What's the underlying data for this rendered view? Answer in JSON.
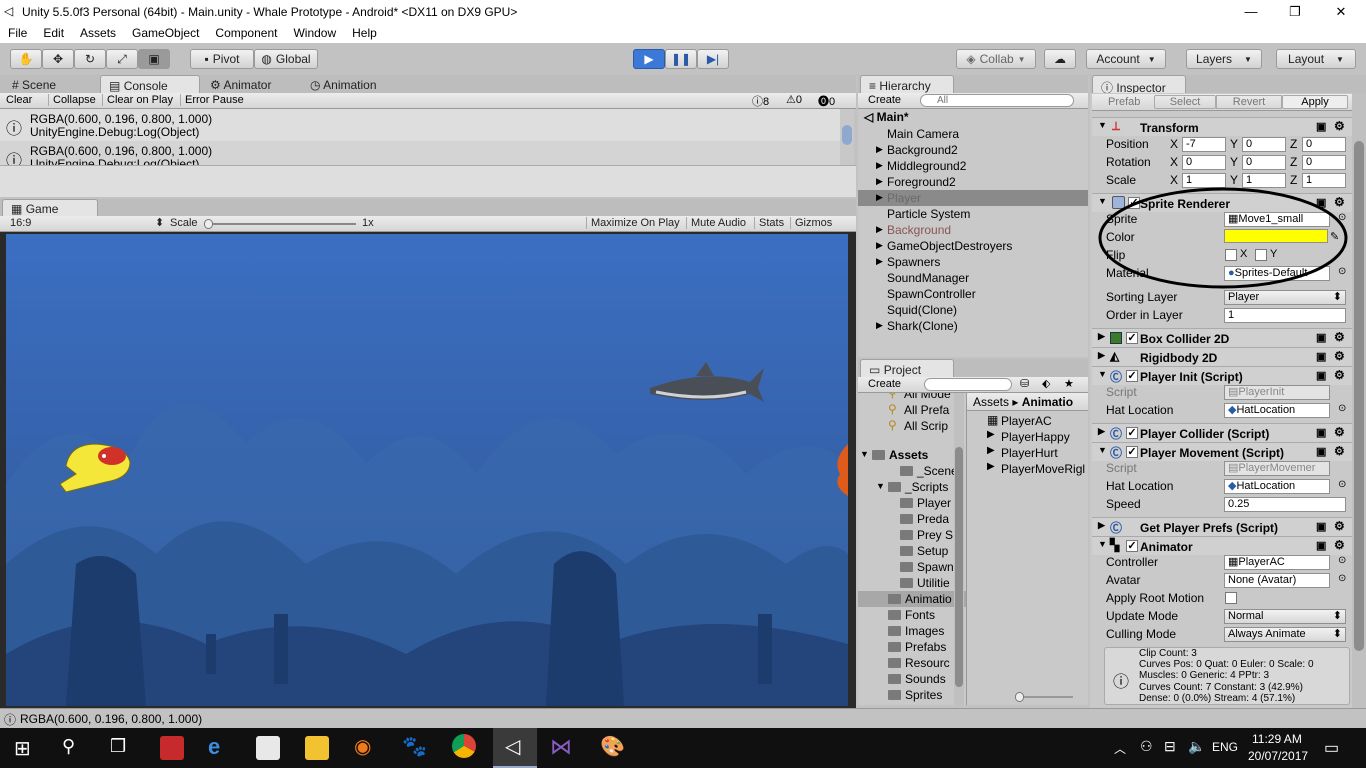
{
  "window": {
    "title": "Unity 5.5.0f3 Personal (64bit) - Main.unity - Whale Prototype - Android* <DX11 on DX9 GPU>",
    "minimize": "—",
    "maximize": "❐",
    "close": "✕"
  },
  "menu": [
    "File",
    "Edit",
    "Assets",
    "GameObject",
    "Component",
    "Window",
    "Help"
  ],
  "toolbar": {
    "pivot": "Pivot",
    "global": "Global",
    "collab": "Collab",
    "account": "Account",
    "layers": "Layers",
    "layout": "Layout"
  },
  "tabs_left": {
    "scene": "Scene",
    "console": "Console",
    "animator": "Animator",
    "animation": "Animation"
  },
  "console": {
    "clear": "Clear",
    "collapse": "Collapse",
    "clear_on_play": "Clear on Play",
    "error_pause": "Error Pause",
    "count_info": "8",
    "count_warn": "0",
    "count_err": "0",
    "entries": [
      {
        "line1": "RGBA(0.600, 0.196, 0.800, 1.000)",
        "line2": "UnityEngine.Debug:Log(Object)"
      },
      {
        "line1": "RGBA(0.600, 0.196, 0.800, 1.000)",
        "line2": "UnityEngine.Debug:Log(Object)"
      }
    ]
  },
  "game": {
    "tab": "Game",
    "aspect": "16:9",
    "scale_label": "Scale",
    "scale_value": "1x",
    "maximize": "Maximize On Play",
    "mute": "Mute Audio",
    "stats": "Stats",
    "gizmos": "Gizmos"
  },
  "hierarchy": {
    "tab": "Hierarchy",
    "create": "Create",
    "search_placeholder": "All",
    "scene": "Main*",
    "items": [
      {
        "label": "Main Camera",
        "arrow": false,
        "dim": false,
        "sel": false
      },
      {
        "label": "Background2",
        "arrow": true,
        "dim": false,
        "sel": false
      },
      {
        "label": "Middleground2",
        "arrow": true,
        "dim": false,
        "sel": false
      },
      {
        "label": "Foreground2",
        "arrow": true,
        "dim": false,
        "sel": false
      },
      {
        "label": "Player",
        "arrow": true,
        "dim": true,
        "sel": true
      },
      {
        "label": "Particle System",
        "arrow": false,
        "dim": false,
        "sel": false
      },
      {
        "label": "Background",
        "arrow": true,
        "dim": true,
        "sel": false
      },
      {
        "label": "GameObjectDestroyers",
        "arrow": true,
        "dim": false,
        "sel": false
      },
      {
        "label": "Spawners",
        "arrow": true,
        "dim": false,
        "sel": false
      },
      {
        "label": "SoundManager",
        "arrow": false,
        "dim": false,
        "sel": false
      },
      {
        "label": "SpawnController",
        "arrow": false,
        "dim": false,
        "sel": false
      },
      {
        "label": "Squid(Clone)",
        "arrow": false,
        "dim": false,
        "sel": false
      },
      {
        "label": "Shark(Clone)",
        "arrow": true,
        "dim": false,
        "sel": false
      }
    ]
  },
  "project": {
    "tab": "Project",
    "create": "Create",
    "favorites": [
      "All Mode",
      "All Prefa",
      "All Scrip"
    ],
    "tree": [
      {
        "label": "Assets",
        "bold": true,
        "depth": 0
      },
      {
        "label": "_Scenes",
        "bold": false,
        "depth": 2
      },
      {
        "label": "_Scripts",
        "bold": false,
        "depth": 1
      },
      {
        "label": "Player",
        "bold": false,
        "depth": 2
      },
      {
        "label": "Preda",
        "bold": false,
        "depth": 2
      },
      {
        "label": "Prey S",
        "bold": false,
        "depth": 2
      },
      {
        "label": "Setup",
        "bold": false,
        "depth": 2
      },
      {
        "label": "Spawn",
        "bold": false,
        "depth": 2
      },
      {
        "label": "Utilitie",
        "bold": false,
        "depth": 2
      },
      {
        "label": "Animatio",
        "bold": false,
        "depth": 1
      },
      {
        "label": "Fonts",
        "bold": false,
        "depth": 1
      },
      {
        "label": "Images",
        "bold": false,
        "depth": 1
      },
      {
        "label": "Prefabs",
        "bold": false,
        "depth": 1
      },
      {
        "label": "Resourc",
        "bold": false,
        "depth": 1
      },
      {
        "label": "Sounds",
        "bold": false,
        "depth": 1
      },
      {
        "label": "Sprites",
        "bold": false,
        "depth": 1
      }
    ],
    "breadcrumb_root": "Assets",
    "breadcrumb_current": "Animatio",
    "files": [
      "PlayerAC",
      "PlayerHappy",
      "PlayerHurt",
      "PlayerMoveRigl"
    ]
  },
  "inspector": {
    "tab": "Inspector",
    "prefab": "Prefab",
    "select": "Select",
    "revert": "Revert",
    "apply": "Apply",
    "transform": {
      "title": "Transform",
      "position_label": "Position",
      "rotation_label": "Rotation",
      "scale_label": "Scale",
      "pos": [
        "-7",
        "0",
        "0"
      ],
      "rot": [
        "0",
        "0",
        "0"
      ],
      "scl": [
        "1",
        "1",
        "1"
      ],
      "x": "X",
      "y": "Y",
      "z": "Z"
    },
    "sprite_renderer": {
      "title": "Sprite Renderer",
      "sprite_label": "Sprite",
      "sprite_value": "Move1_small",
      "color_label": "Color",
      "color_value": "#ffff00",
      "flip_label": "Flip",
      "flip_x": "X",
      "flip_y": "Y",
      "material_label": "Material",
      "material_value": "Sprites-Default",
      "sorting_layer_label": "Sorting Layer",
      "sorting_layer_value": "Player",
      "order_label": "Order in Layer",
      "order_value": "1"
    },
    "box_collider": {
      "title": "Box Collider 2D"
    },
    "rigidbody": {
      "title": "Rigidbody 2D"
    },
    "player_init": {
      "title": "Player Init (Script)",
      "script_label": "Script",
      "script_value": "PlayerInit",
      "hat_label": "Hat Location",
      "hat_value": "HatLocation"
    },
    "player_collider": {
      "title": "Player Collider (Script)"
    },
    "player_movement": {
      "title": "Player Movement (Script)",
      "script_label": "Script",
      "script_value": "PlayerMovemer",
      "hat_label": "Hat Location",
      "hat_value": "HatLocation",
      "speed_label": "Speed",
      "speed_value": "0.25"
    },
    "get_prefs": {
      "title": "Get Player Prefs (Script)"
    },
    "animator": {
      "title": "Animator",
      "controller_label": "Controller",
      "controller_value": "PlayerAC",
      "avatar_label": "Avatar",
      "avatar_value": "None (Avatar)",
      "root_motion_label": "Apply Root Motion",
      "update_label": "Update Mode",
      "update_value": "Normal",
      "culling_label": "Culling Mode",
      "culling_value": "Always Animate",
      "info": [
        "Clip Count: 3",
        "Curves Pos: 0 Quat: 0 Euler: 0 Scale: 0",
        "Muscles: 0 Generic: 4 PPtr: 3",
        "Curves Count: 7 Constant: 3 (42.9%)",
        "Dense: 0 (0.0%) Stream: 4 (57.1%)"
      ]
    }
  },
  "status": {
    "text": "RGBA(0.600, 0.196, 0.800, 1.000)"
  },
  "taskbar": {
    "time": "11:29 AM",
    "date": "20/07/2017",
    "lang": "ENG"
  },
  "colors": {
    "ocean": "#3b6fc2",
    "selected_row": "#8a8a8a",
    "accent_play": "#3c78d8"
  }
}
